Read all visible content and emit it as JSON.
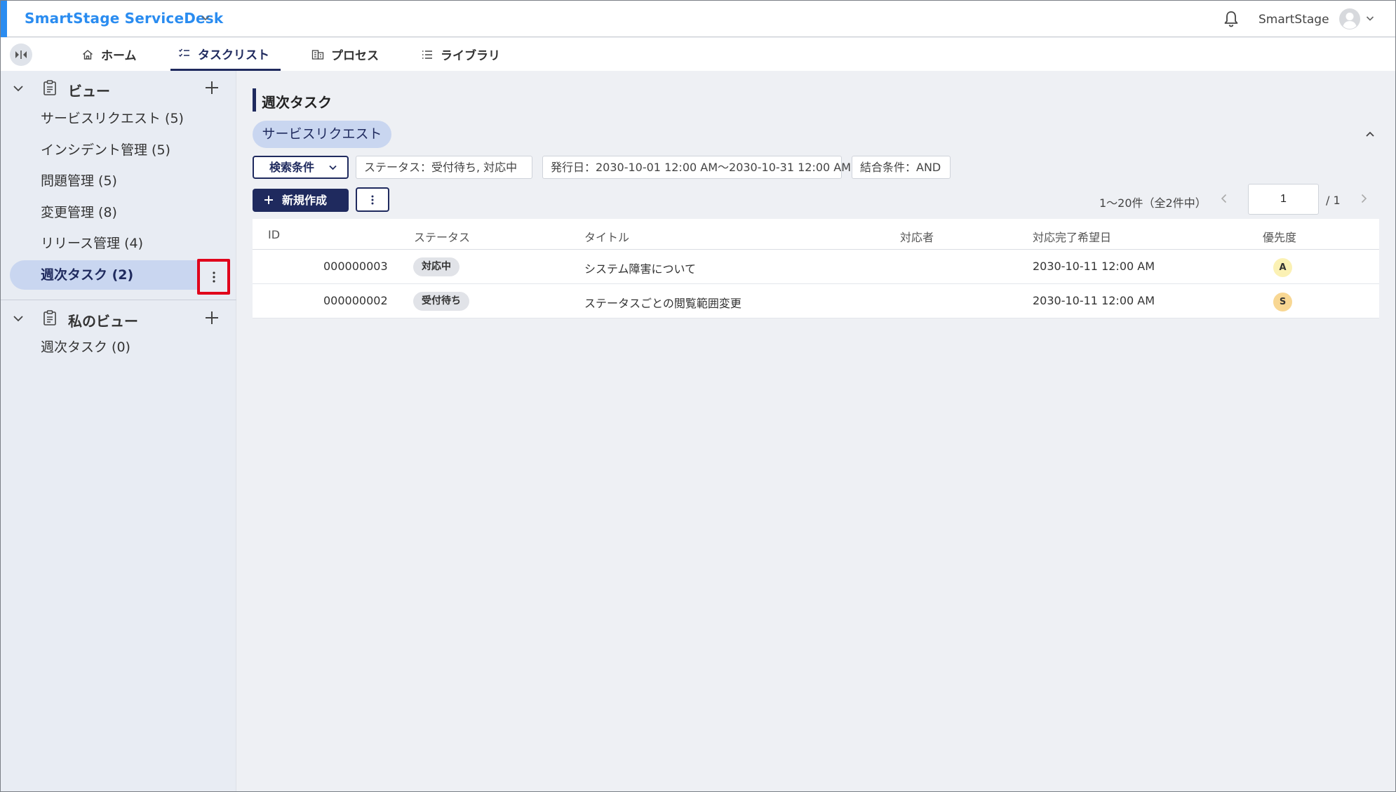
{
  "header": {
    "app_title": "SmartStage ServiceDesk",
    "user_name": "SmartStage"
  },
  "tabs": [
    {
      "label": "ホーム",
      "icon": "home-icon"
    },
    {
      "label": "タスクリスト",
      "icon": "task-list-icon",
      "active": true
    },
    {
      "label": "プロセス",
      "icon": "process-icon"
    },
    {
      "label": "ライブラリ",
      "icon": "library-icon"
    }
  ],
  "sidebar": {
    "views_header": "ビュー",
    "views": [
      {
        "label": "サービスリクエスト (5)"
      },
      {
        "label": "インシデント管理 (5)"
      },
      {
        "label": "問題管理 (5)"
      },
      {
        "label": "変更管理 (8)"
      },
      {
        "label": "リリース管理 (4)"
      },
      {
        "label": "週次タスク (2)",
        "selected": true
      }
    ],
    "my_views_header": "私のビュー",
    "my_views": [
      {
        "label": "週次タスク (0)"
      }
    ]
  },
  "main": {
    "title": "週次タスク",
    "category_chip": "サービスリクエスト",
    "search_button": "検索条件",
    "filters": [
      "ステータス：受付待ち, 対応中",
      "発行日：2030-10-01 12:00 AM〜2030-10-31 12:00 AM",
      "結合条件：AND"
    ],
    "new_button": "新規作成",
    "pager": {
      "summary": "1〜20件（全2件中）",
      "page": "1",
      "total": "/ 1"
    },
    "columns": [
      "ID",
      "ステータス",
      "タイトル",
      "対応者",
      "対応完了希望日",
      "優先度"
    ],
    "rows": [
      {
        "id": "000000003",
        "status": "対応中",
        "title": "システム障害について",
        "assignee": "",
        "due": "2030-10-11 12:00 AM",
        "priority": "A",
        "priority_color": "#fbf1b4"
      },
      {
        "id": "000000002",
        "status": "受付待ち",
        "title": "ステータスごとの閲覧範囲変更",
        "assignee": "",
        "due": "2030-10-11 12:00 AM",
        "priority": "S",
        "priority_color": "#f8d793"
      }
    ]
  },
  "colors": {
    "accent": "#2a8cf0",
    "navy": "#1f2a5e",
    "highlight_box": "#e0001b"
  }
}
